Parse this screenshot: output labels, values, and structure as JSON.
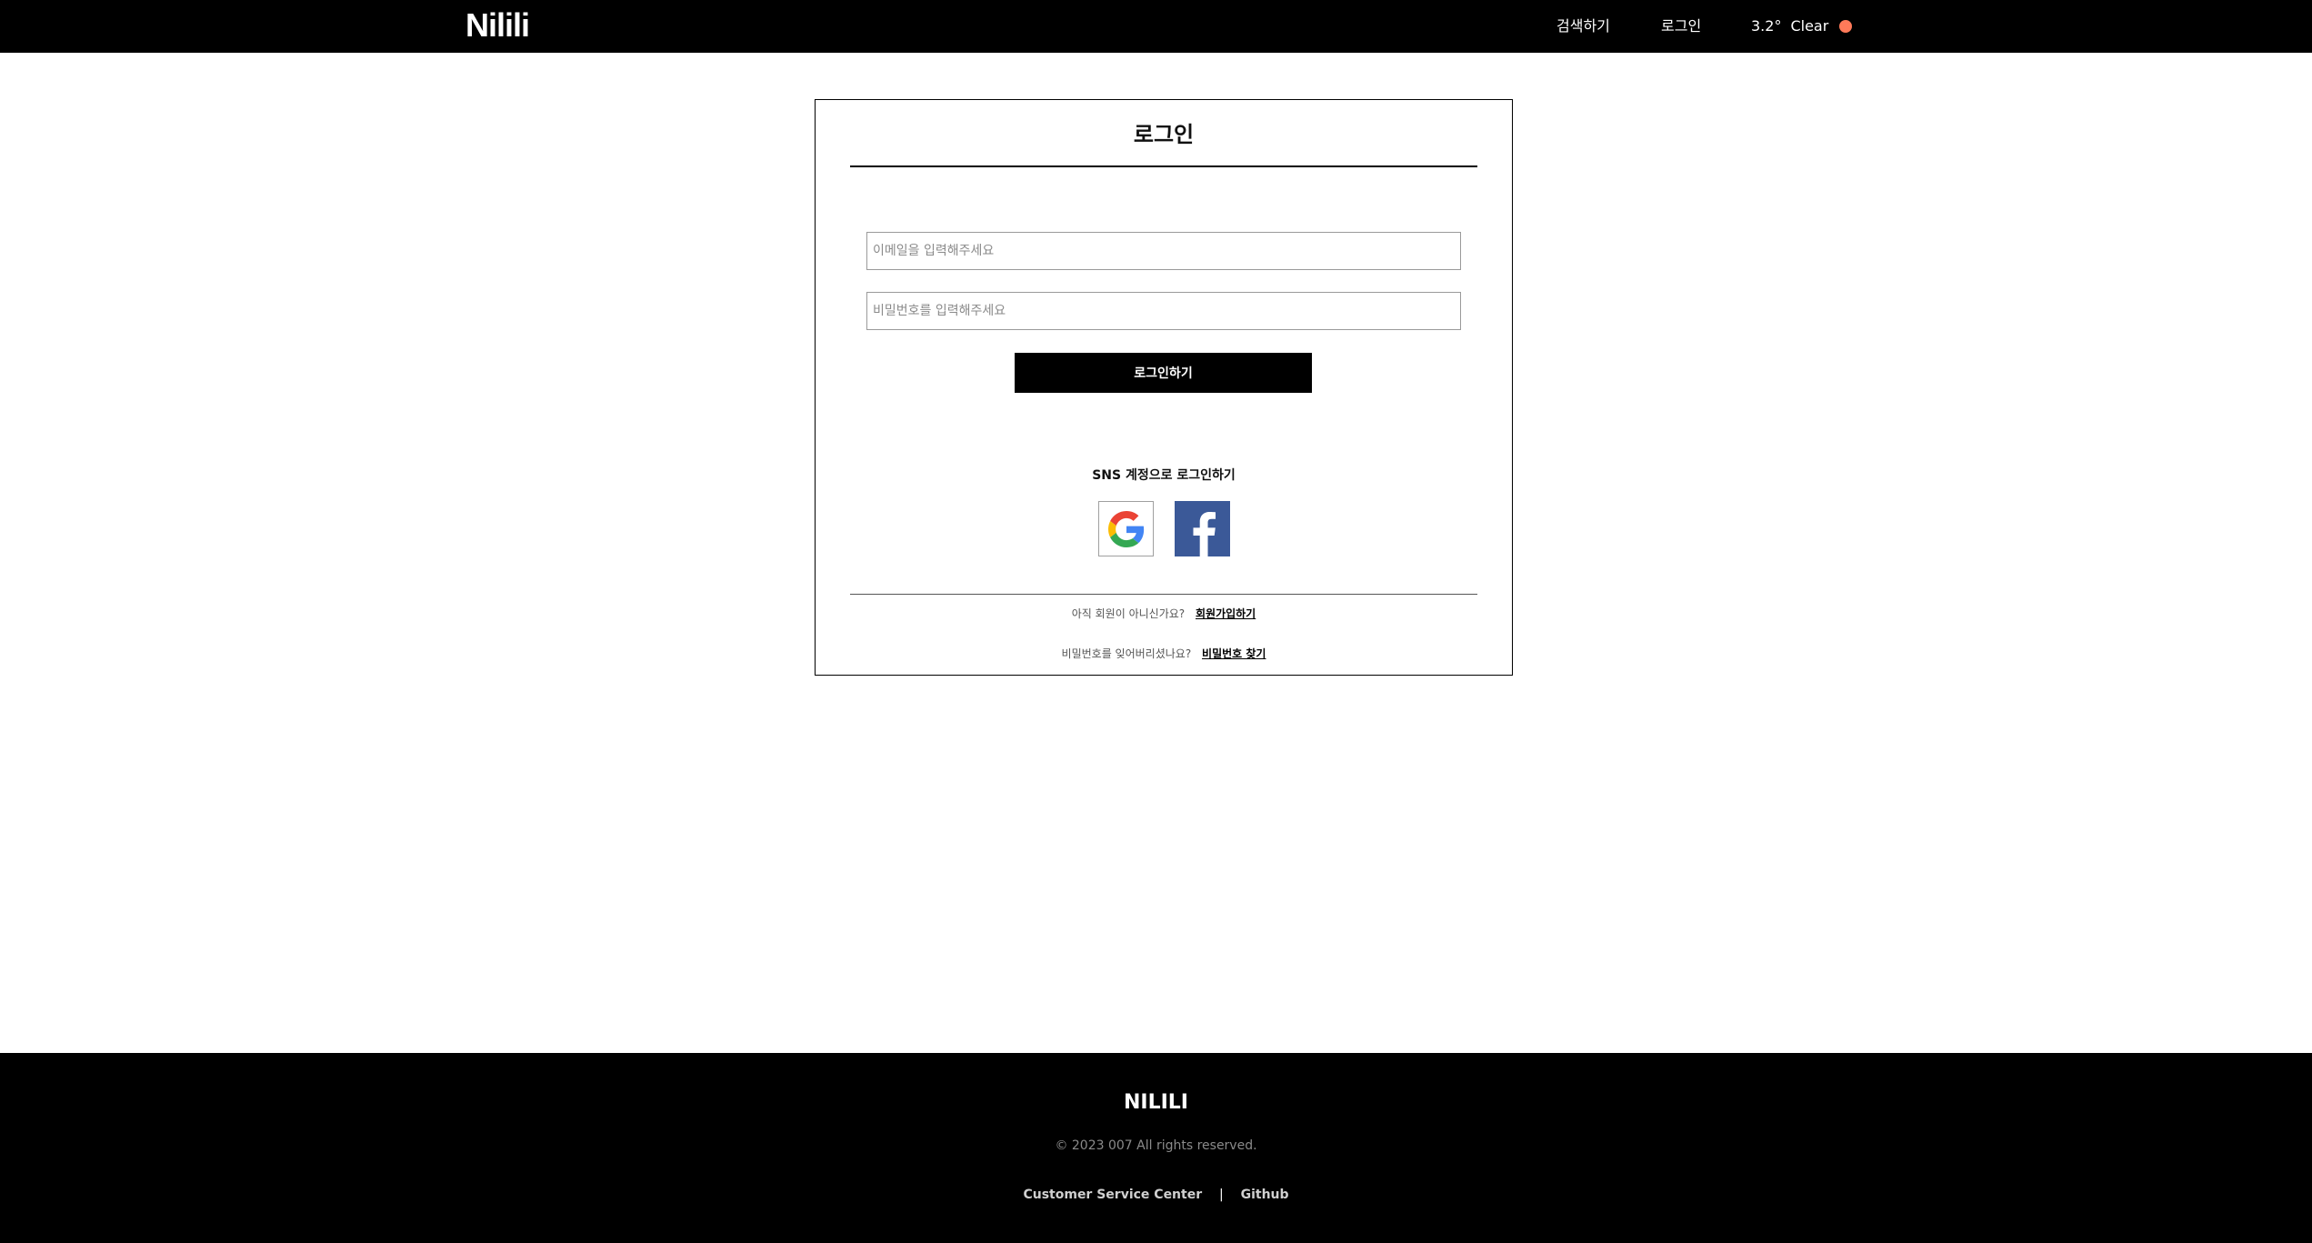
{
  "header": {
    "logo": "Nilili",
    "nav": {
      "search": "검색하기",
      "login": "로그인"
    },
    "weather": {
      "temperature": "3.2°",
      "condition": "Clear",
      "indicator_color": "#ff7a59"
    }
  },
  "login": {
    "title": "로그인",
    "email_placeholder": "이메일을 입력해주세요",
    "password_placeholder": "비밀번호를 입력해주세요",
    "submit_label": "로그인하기",
    "sns_title": "SNS 계정으로 로그인하기",
    "sns_icons": [
      "google-icon",
      "facebook-icon"
    ],
    "signup_prompt": "아직 회원이 아니신가요?",
    "signup_link": "회원가입하기",
    "forgot_prompt": "비밀번호를 잊어버리셨나요?",
    "forgot_link": "비밀번호 찾기"
  },
  "footer": {
    "brand": "NILILI",
    "copyright": "© 2023 007 All rights reserved.",
    "links": {
      "customer_service": "Customer Service Center",
      "separator": "|",
      "github": "Github"
    }
  }
}
